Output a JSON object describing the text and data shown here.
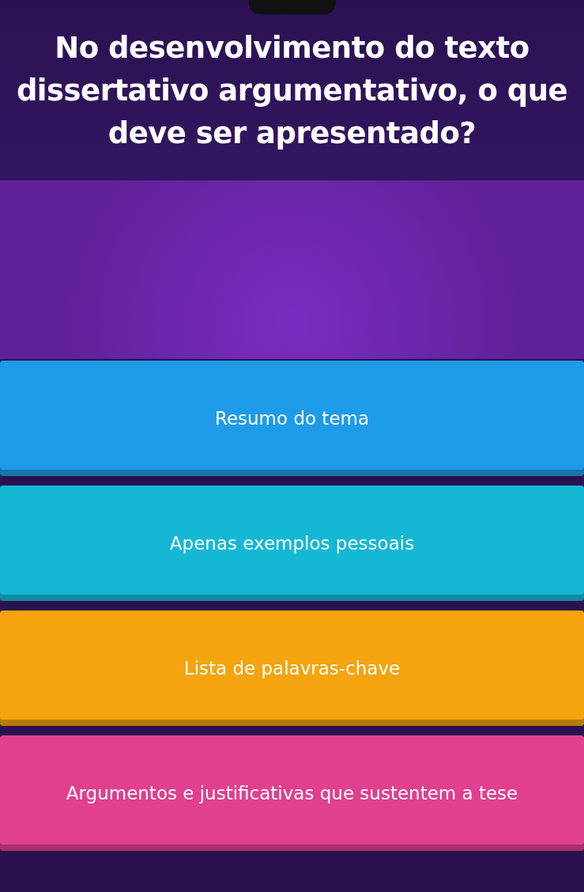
{
  "question": {
    "text": "No desenvolvimento do texto dissertativo argumentativo, o que deve ser apresentado?"
  },
  "options": [
    {
      "text": "Resumo do tema",
      "color": "#1e9be8"
    },
    {
      "text": "Apenas exemplos pessoais",
      "color": "#14b8d4"
    },
    {
      "text": "Lista de palavras-chave",
      "color": "#f3a40f"
    },
    {
      "text": "Argumentos e justificativas que sustentem a tese",
      "color": "#e0408e"
    }
  ]
}
